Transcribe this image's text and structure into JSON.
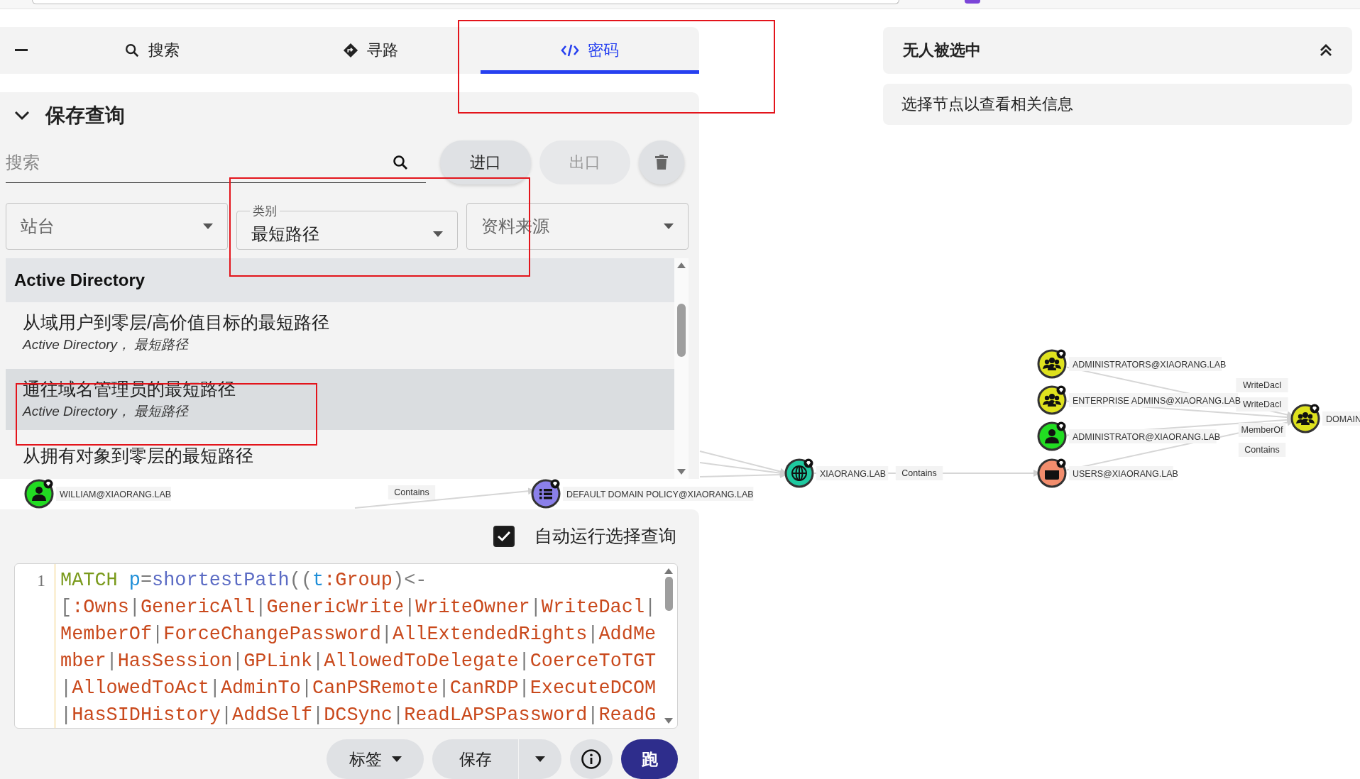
{
  "tabs": [
    {
      "label": "搜索",
      "selected": false
    },
    {
      "label": "寻路",
      "selected": false
    },
    {
      "label": "密码",
      "selected": true
    }
  ],
  "saved_queries": {
    "title": "保存查询",
    "expanded": true,
    "search": {
      "placeholder": "搜索"
    },
    "buttons": [
      {
        "label": "进口",
        "disabled": false
      },
      {
        "label": "出口",
        "disabled": true
      }
    ],
    "filters": [
      {
        "placeholder": "站台"
      },
      {
        "label": "类别",
        "value": "最短路径"
      },
      {
        "placeholder": "资料来源"
      }
    ],
    "groups": [
      {
        "title": "Active Directory",
        "items": [
          {
            "title": "从域用户到零层/高价值目标的最短路径",
            "subtitle": "Active Directory， 最短路径",
            "selected": false
          },
          {
            "title": "通往域名管理员的最短路径",
            "subtitle": "Active Directory， 最短路径",
            "selected": true
          },
          {
            "title": "从拥有对象到零层的最短路径",
            "selected": false
          }
        ]
      }
    ]
  },
  "editor": {
    "auto_run": {
      "label": "自动运行选择查询",
      "checked": true
    },
    "line_numbers": [
      "1"
    ],
    "tokens": [
      {
        "text": "MATCH",
        "kind": "keyword"
      },
      {
        "text": "p",
        "kind": "variable"
      },
      {
        "text": "=",
        "kind": "punct"
      },
      {
        "text": "shortestPath",
        "kind": "function"
      },
      {
        "text": "((",
        "kind": "punct"
      },
      {
        "text": "t",
        "kind": "variable"
      },
      {
        "text": ":Group",
        "kind": "label"
      },
      {
        "text": ")<-",
        "kind": "punct"
      },
      {
        "text": "[",
        "kind": "punct"
      },
      {
        "text": ":Owns",
        "kind": "label"
      },
      {
        "text": "|",
        "kind": "punct"
      },
      {
        "text": "GenericAll",
        "kind": "label"
      },
      {
        "text": "|",
        "kind": "punct"
      },
      {
        "text": "GenericWrite",
        "kind": "label"
      },
      {
        "text": "|",
        "kind": "punct"
      },
      {
        "text": "WriteOwner",
        "kind": "label"
      },
      {
        "text": "|",
        "kind": "punct"
      },
      {
        "text": "WriteDacl",
        "kind": "label"
      },
      {
        "text": "|",
        "kind": "punct"
      },
      {
        "text": "MemberOf",
        "kind": "label"
      },
      {
        "text": "|",
        "kind": "punct"
      },
      {
        "text": "ForceChangePassword",
        "kind": "label"
      },
      {
        "text": "|",
        "kind": "punct"
      },
      {
        "text": "AllExtendedRights",
        "kind": "label"
      },
      {
        "text": "|",
        "kind": "punct"
      },
      {
        "text": "AddMember",
        "kind": "label"
      },
      {
        "text": "|",
        "kind": "punct"
      },
      {
        "text": "HasSession",
        "kind": "label"
      },
      {
        "text": "|",
        "kind": "punct"
      },
      {
        "text": "GPLink",
        "kind": "label"
      },
      {
        "text": "|",
        "kind": "punct"
      },
      {
        "text": "AllowedToDelegate",
        "kind": "label"
      },
      {
        "text": "|",
        "kind": "punct"
      },
      {
        "text": "CoerceToTGT",
        "kind": "label"
      },
      {
        "text": "|",
        "kind": "punct"
      },
      {
        "text": "AllowedToAct",
        "kind": "label"
      },
      {
        "text": "|",
        "kind": "punct"
      },
      {
        "text": "AdminTo",
        "kind": "label"
      },
      {
        "text": "|",
        "kind": "punct"
      },
      {
        "text": "CanPSRemote",
        "kind": "label"
      },
      {
        "text": "|",
        "kind": "punct"
      },
      {
        "text": "CanRDP",
        "kind": "label"
      },
      {
        "text": "|",
        "kind": "punct"
      },
      {
        "text": "ExecuteDCOM",
        "kind": "label"
      },
      {
        "text": "|",
        "kind": "punct"
      },
      {
        "text": "HasSIDHistory",
        "kind": "label"
      },
      {
        "text": "|",
        "kind": "punct"
      },
      {
        "text": "AddSelf",
        "kind": "label"
      },
      {
        "text": "|",
        "kind": "punct"
      },
      {
        "text": "DCSync",
        "kind": "label"
      },
      {
        "text": "|",
        "kind": "punct"
      },
      {
        "text": "ReadLAPSPassword",
        "kind": "label"
      },
      {
        "text": "|",
        "kind": "punct"
      },
      {
        "text": "ReadG",
        "kind": "label"
      }
    ]
  },
  "actions": [
    {
      "label": "标签",
      "kind": "menu"
    },
    {
      "label": "保存",
      "kind": "split"
    },
    {
      "kind": "info"
    },
    {
      "label": "跑",
      "kind": "primary"
    }
  ],
  "selection": {
    "title": "无人被选中",
    "expanded": true,
    "message": "选择节点以查看相关信息"
  },
  "graph": {
    "nodes": [
      {
        "label": "WILLIAM@XIAORANG.LAB",
        "kind": "user",
        "color": "#22dc22"
      },
      {
        "label": "DEFAULT DOMAIN POLICY@XIAORANG.LAB",
        "kind": "gpo",
        "color": "#8b80ea"
      },
      {
        "label": "XIAORANG.LAB",
        "kind": "domain",
        "color": "#1fc9a0"
      },
      {
        "label": "ADMINISTRATORS@XIAORANG.LAB",
        "kind": "group",
        "color": "#dfe21e"
      },
      {
        "label": "ENTERPRISE ADMINS@XIAORANG.LAB",
        "kind": "group",
        "color": "#dfe21e"
      },
      {
        "label": "ADMINISTRATOR@XIAORANG.LAB",
        "kind": "user",
        "color": "#22dc22"
      },
      {
        "label": "USERS@XIAORANG.LAB",
        "kind": "container",
        "color": "#f28d6d"
      },
      {
        "label": "DOMAIN",
        "kind": "group",
        "color": "#dfe21e"
      }
    ],
    "edges": [
      {
        "label": "Contains"
      },
      {
        "label": "Contains"
      },
      {
        "label": "WriteDacl"
      },
      {
        "label": "WriteDacl"
      },
      {
        "label": "MemberOf"
      },
      {
        "label": "Contains"
      }
    ]
  }
}
